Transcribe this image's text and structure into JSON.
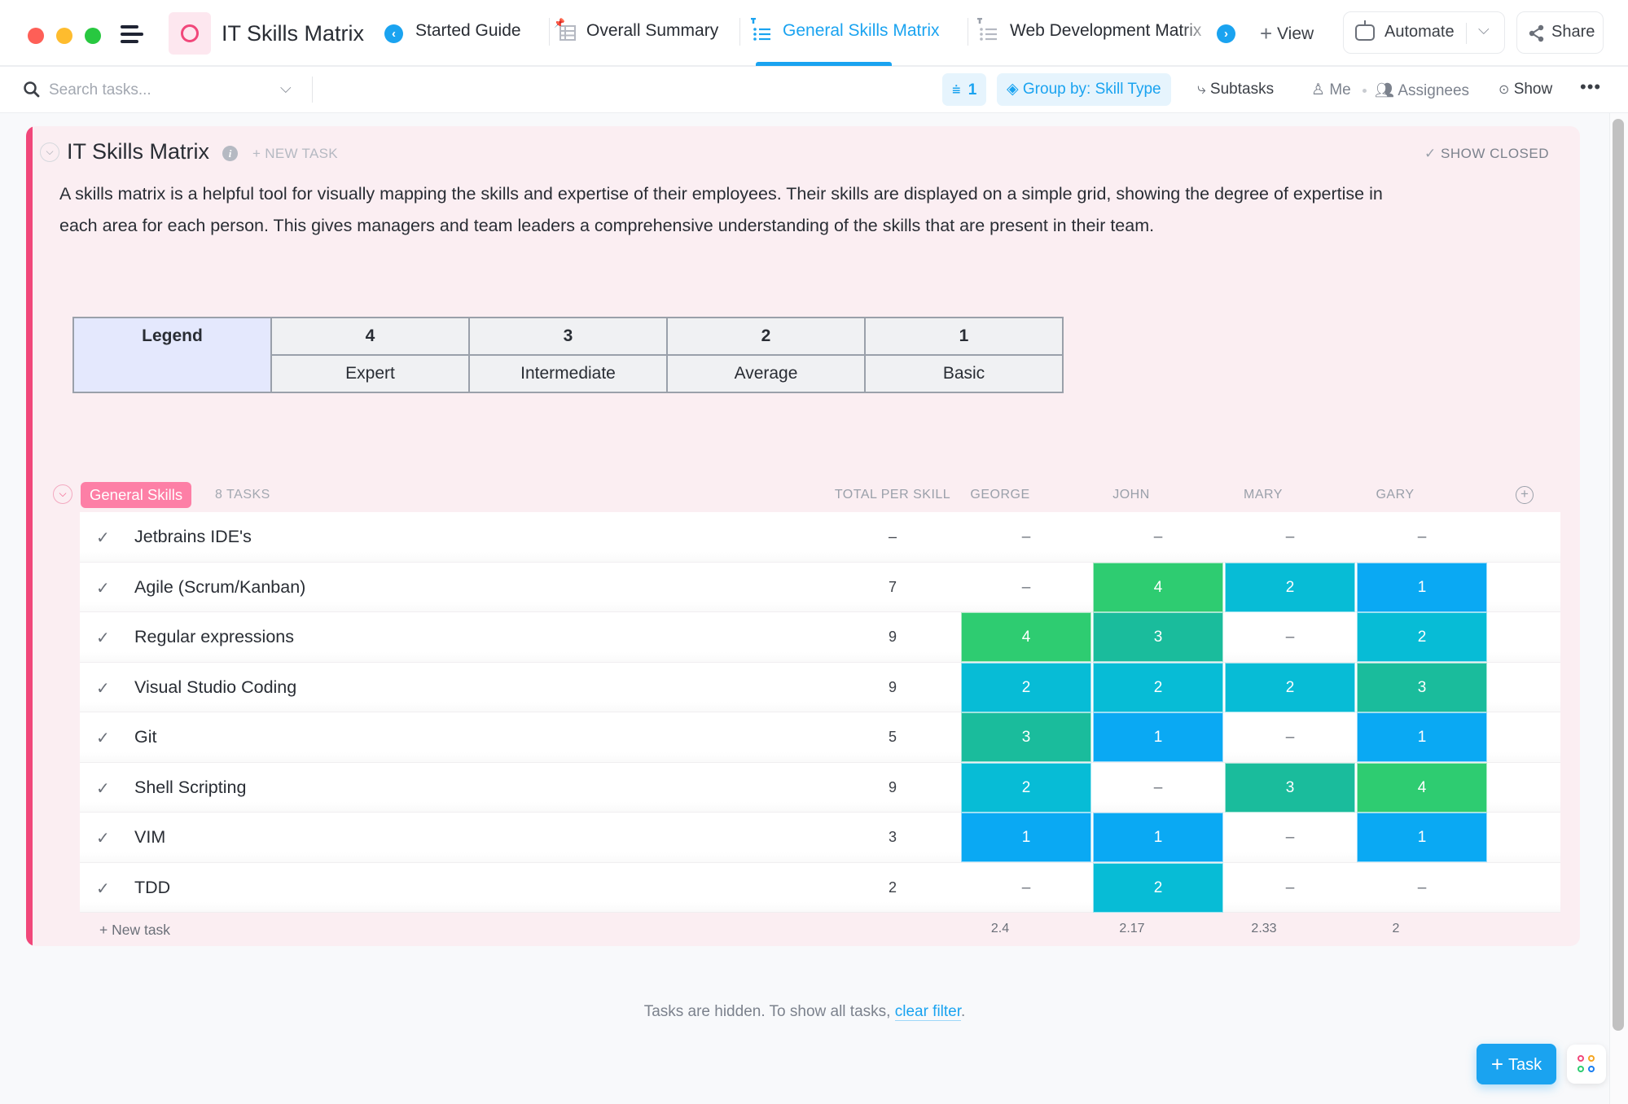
{
  "window": {
    "space_title": "IT Skills Matrix",
    "tabs": [
      {
        "label": "Started Guide",
        "icon": "doc-icon",
        "active": false
      },
      {
        "label": "Overall Summary",
        "icon": "table-icon",
        "active": false
      },
      {
        "label": "General Skills Matrix",
        "icon": "list-icon",
        "active": true
      },
      {
        "label": "Web Development Matrix",
        "icon": "list-icon",
        "active": false
      }
    ],
    "view_label": "View",
    "automate_label": "Automate",
    "share_label": "Share"
  },
  "toolbar": {
    "search_placeholder": "Search tasks...",
    "filter_count": "1",
    "group_by_label": "Group by: Skill Type",
    "subtasks_label": "Subtasks",
    "me_label": "Me",
    "assignees_label": "Assignees",
    "show_label": "Show"
  },
  "list": {
    "title": "IT Skills Matrix",
    "new_task_label": "+ NEW TASK",
    "show_closed_label": "SHOW CLOSED",
    "description": "A skills matrix is a helpful tool for visually mapping the skills and expertise of their employees. Their skills are displayed on a simple grid, showing the degree of expertise in each area for each person. This gives managers and team leaders a comprehensive understanding of the skills that are present in their team."
  },
  "legend": {
    "title": "Legend",
    "levels": [
      {
        "value": "4",
        "label": "Expert"
      },
      {
        "value": "3",
        "label": "Intermediate"
      },
      {
        "value": "2",
        "label": "Average"
      },
      {
        "value": "1",
        "label": "Basic"
      }
    ]
  },
  "level_colors": {
    "4": "#2ecc71",
    "3": "#1abc9c",
    "2": "#07bcd6",
    "1": "#0aa9f3"
  },
  "group": {
    "name": "General Skills",
    "task_count": "8 TASKS",
    "columns": {
      "total": "TOTAL PER SKILL",
      "people": [
        "GEORGE",
        "JOHN",
        "MARY",
        "GARY"
      ]
    },
    "rows": [
      {
        "name": "Jetbrains IDE's",
        "total": "–",
        "scores": [
          "–",
          "–",
          "–",
          "–"
        ]
      },
      {
        "name": "Agile (Scrum/Kanban)",
        "total": "7",
        "scores": [
          "–",
          "4",
          "2",
          "1"
        ]
      },
      {
        "name": "Regular expressions",
        "total": "9",
        "scores": [
          "4",
          "3",
          "–",
          "2"
        ]
      },
      {
        "name": "Visual Studio Coding",
        "total": "9",
        "scores": [
          "2",
          "2",
          "2",
          "3"
        ]
      },
      {
        "name": "Git",
        "total": "5",
        "scores": [
          "3",
          "1",
          "–",
          "1"
        ]
      },
      {
        "name": "Shell Scripting",
        "total": "9",
        "scores": [
          "2",
          "–",
          "3",
          "4"
        ]
      },
      {
        "name": "VIM",
        "total": "3",
        "scores": [
          "1",
          "1",
          "–",
          "1"
        ]
      },
      {
        "name": "TDD",
        "total": "2",
        "scores": [
          "–",
          "2",
          "–",
          "–"
        ]
      }
    ],
    "new_task_label": "+ New task",
    "averages": [
      "2.4",
      "2.17",
      "2.33",
      "2"
    ]
  },
  "footer": {
    "hidden_text": "Tasks are hidden. To show all tasks, ",
    "clear_filter_label": "clear filter",
    "hidden_suffix": ".",
    "task_button_label": "Task"
  }
}
